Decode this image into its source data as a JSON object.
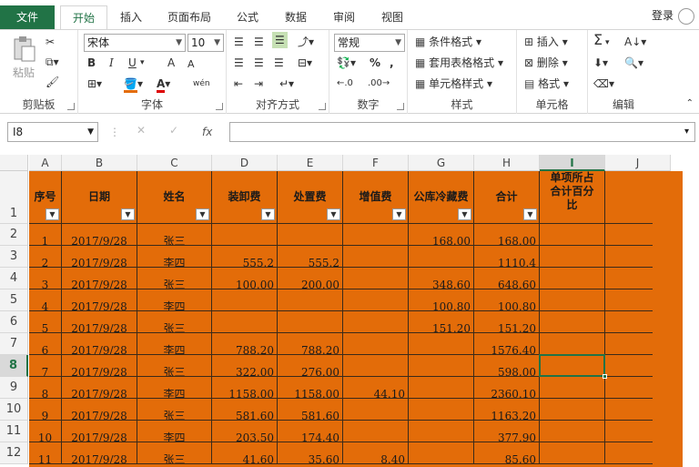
{
  "tabs": {
    "file": "文件",
    "items": [
      "开始",
      "插入",
      "页面布局",
      "公式",
      "数据",
      "审阅",
      "视图"
    ],
    "login": "登录"
  },
  "ribbon": {
    "clipboard": {
      "paste": "粘贴",
      "label": "剪贴板"
    },
    "font": {
      "name": "宋体",
      "size": "10",
      "label": "字体",
      "bold": "B",
      "italic": "I",
      "underline": "U",
      "grow": "A",
      "shrink": "A",
      "phonetic": "wén"
    },
    "alignment": {
      "label": "对齐方式"
    },
    "number": {
      "format": "常规",
      "label": "数字",
      "percent": "%",
      "comma": ","
    },
    "styles": {
      "conditional": "条件格式",
      "table": "套用表格格式",
      "cell": "单元格样式",
      "label": "样式"
    },
    "cells": {
      "insert": "插入",
      "delete": "删除",
      "format": "格式",
      "label": "单元格"
    },
    "editing": {
      "label": "编辑",
      "sum": "Σ"
    }
  },
  "formula_bar": {
    "name_box": "I8",
    "fx": "fx",
    "value": ""
  },
  "columns": [
    "A",
    "B",
    "C",
    "D",
    "E",
    "F",
    "G",
    "H",
    "I",
    "J"
  ],
  "selected_column": "I",
  "selected_row": "8",
  "headers": [
    "序号",
    "日期",
    "姓名",
    "装卸费",
    "处置费",
    "增值费",
    "公库冷藏费",
    "合计",
    "单项所占合计百分比"
  ],
  "rows": [
    {
      "n": "2",
      "cells": [
        "1",
        "2017/9/28",
        "张三",
        "",
        "",
        "",
        "168.00",
        "168.00",
        ""
      ]
    },
    {
      "n": "3",
      "cells": [
        "2",
        "2017/9/28",
        "李四",
        "555.2",
        "555.2",
        "",
        "",
        "1110.4",
        ""
      ]
    },
    {
      "n": "4",
      "cells": [
        "3",
        "2017/9/28",
        "张三",
        "100.00",
        "200.00",
        "",
        "348.60",
        "648.60",
        ""
      ]
    },
    {
      "n": "5",
      "cells": [
        "4",
        "2017/9/28",
        "李四",
        "",
        "",
        "",
        "100.80",
        "100.80",
        ""
      ]
    },
    {
      "n": "6",
      "cells": [
        "5",
        "2017/9/28",
        "张三",
        "",
        "",
        "",
        "151.20",
        "151.20",
        ""
      ]
    },
    {
      "n": "7",
      "cells": [
        "6",
        "2017/9/28",
        "李四",
        "788.20",
        "788.20",
        "",
        "",
        "1576.40",
        ""
      ]
    },
    {
      "n": "8",
      "cells": [
        "7",
        "2017/9/28",
        "张三",
        "322.00",
        "276.00",
        "",
        "",
        "598.00",
        ""
      ]
    },
    {
      "n": "9",
      "cells": [
        "8",
        "2017/9/28",
        "李四",
        "1158.00",
        "1158.00",
        "44.10",
        "",
        "2360.10",
        ""
      ]
    },
    {
      "n": "10",
      "cells": [
        "9",
        "2017/9/28",
        "张三",
        "581.60",
        "581.60",
        "",
        "",
        "1163.20",
        ""
      ]
    },
    {
      "n": "11",
      "cells": [
        "10",
        "2017/9/28",
        "李四",
        "203.50",
        "174.40",
        "",
        "",
        "377.90",
        ""
      ]
    },
    {
      "n": "12",
      "cells": [
        "11",
        "2017/9/28",
        "张三",
        "41.60",
        "35.60",
        "8.40",
        "",
        "85.60",
        ""
      ]
    }
  ],
  "header_row_number": "1",
  "colors": {
    "accent": "#217346",
    "fill": "#e36c09"
  }
}
